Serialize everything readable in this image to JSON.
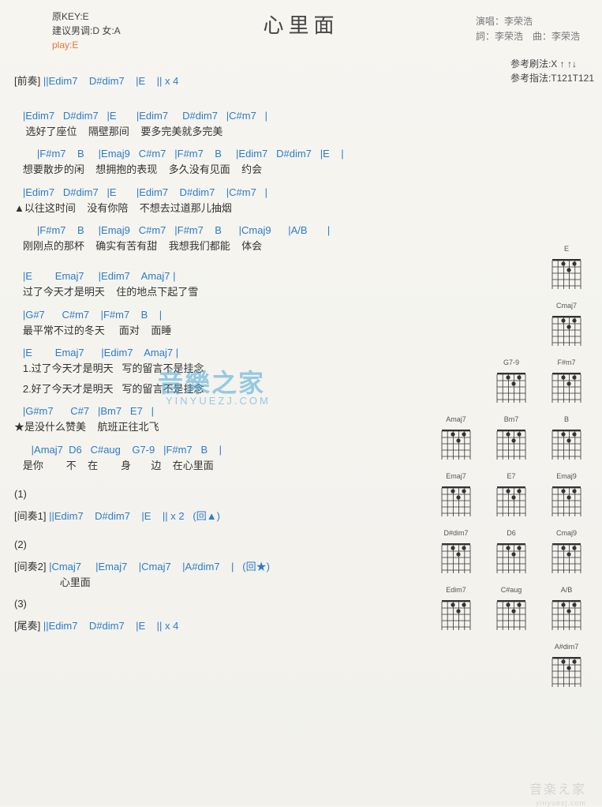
{
  "header": {
    "original_key": "原KEY:E",
    "suggest": "建议男调:D 女:A",
    "play": "play:E",
    "title": "心里面",
    "singer_label": "演唱：",
    "singer": "李荣浩",
    "lyricist_label": "詞：",
    "lyricist": "李荣浩",
    "composer_label": "曲：",
    "composer": "李荣浩",
    "ref_strum_label": "参考刷法:",
    "ref_strum": "X ↑ ↑↓",
    "ref_finger_label": "参考指法:",
    "ref_finger": "T121T121"
  },
  "intro": {
    "label": "[前奏]",
    "chords": " ||Edim7    D#dim7    |E    || x 4"
  },
  "verse1": {
    "l1_chords": "   |Edim7   D#dim7   |E       |Edim7     D#dim7   |C#m7   |",
    "l1_lyrics": "    选好了座位    隔壁那间    要多完美就多完美",
    "l2_chords": "        |F#m7    B     |Emaj9   C#m7   |F#m7    B     |Edim7   D#dim7   |E    |",
    "l2_lyrics": "   想要散步的闲    想拥抱的表现    多久没有见面    约会",
    "l3_chords": "   |Edim7   D#dim7   |E       |Edim7    D#dim7    |C#m7   |",
    "l3_lyrics": "▲以往这时间    没有你陪    不想去过道那儿抽烟",
    "l4_chords": "        |F#m7    B     |Emaj9   C#m7   |F#m7    B      |Cmaj9      |A/B       |",
    "l4_lyrics": "   刚刚点的那杯    确实有苦有甜    我想我们都能    体会"
  },
  "chorus": {
    "l1_chords": "   |E        Emaj7     |Edim7    Amaj7 |",
    "l1_lyrics": "   过了今天才是明天    住的地点下起了雪",
    "l2_chords": "   |G#7      C#m7    |F#m7    B    |",
    "l2_lyrics": "   最平常不过的冬天     面对    面睡",
    "l3_chords": "   |E        Emaj7      |Edim7    Amaj7 |",
    "l3a_lyrics": "   1.过了今天才是明天   写的留言不是挂念",
    "l3b_lyrics": "   2.好了今天才是明天   写的留言不是挂念",
    "l4_chords": "   |G#m7      C#7   |Bm7   E7   |",
    "l4_lyrics": "★是没什么赞美    航班正往北飞",
    "l5_chords": "      |Amaj7  D6   C#aug    G7-9   |F#m7   B    |",
    "l5_lyrics": "   是你        不    在        身       边    在心里面"
  },
  "inter1": {
    "num": "(1)",
    "label": "[间奏1]",
    "chords": " ||Edim7    D#dim7    |E    || x 2   (回▲)"
  },
  "inter2": {
    "num": "(2)",
    "label": "[间奏2]",
    "chords": " |Cmaj7     |Emaj7    |Cmaj7    |A#dim7    |   (回★)",
    "lyric": "                心里面"
  },
  "outro": {
    "num": "(3)",
    "label": "[尾奏]",
    "chords": " ||Edim7    D#dim7    |E    || x 4"
  },
  "diagrams": {
    "row1": [
      {
        "name": "E"
      }
    ],
    "row2": [
      {
        "name": "Cmaj7"
      }
    ],
    "row3": [
      {
        "name": "G7-9"
      },
      {
        "name": "F#m7"
      }
    ],
    "row4": [
      {
        "name": "Amaj7"
      },
      {
        "name": "Bm7"
      },
      {
        "name": "B"
      }
    ],
    "row5": [
      {
        "name": "Emaj7"
      },
      {
        "name": "E7"
      },
      {
        "name": "Emaj9"
      }
    ],
    "row6": [
      {
        "name": "D#dim7"
      },
      {
        "name": "D6"
      },
      {
        "name": "Cmaj9"
      }
    ],
    "row7": [
      {
        "name": "Edim7"
      },
      {
        "name": "C#aug"
      },
      {
        "name": "A/B"
      }
    ],
    "row8": [
      {
        "name": "A#dim7"
      }
    ]
  },
  "watermark": {
    "main": "音樂之家",
    "sub": "YINYUEZJ.COM",
    "bottom": "音楽え家",
    "bottom_sub": "yinyuezj.com"
  }
}
